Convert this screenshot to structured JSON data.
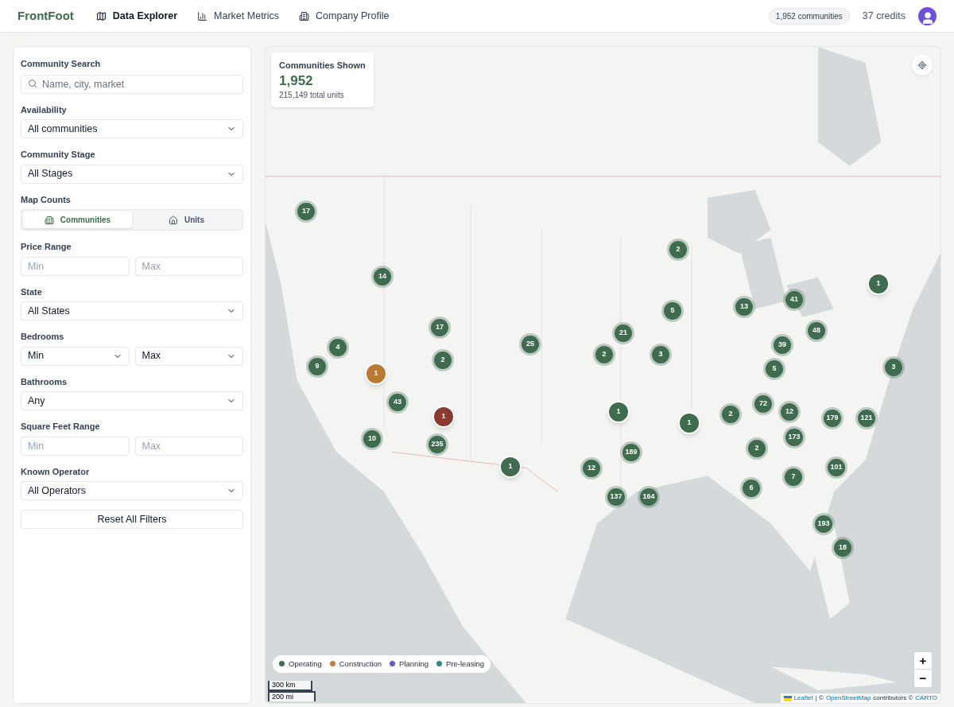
{
  "header": {
    "brand": "FrontFoot",
    "nav": [
      {
        "label": "Data Explorer",
        "selected": true
      },
      {
        "label": "Market Metrics",
        "selected": false
      },
      {
        "label": "Company Profile",
        "selected": false
      }
    ],
    "count_badge": "1,952 communities",
    "credits": "37 credits"
  },
  "filters": {
    "search": {
      "label": "Community Search",
      "placeholder": "Name, city, market"
    },
    "availability": {
      "label": "Availability",
      "value": "All communities"
    },
    "stage": {
      "label": "Community Stage",
      "value": "All Stages"
    },
    "map_counts": {
      "label": "Map Counts",
      "options": [
        {
          "label": "Communities",
          "selected": true
        },
        {
          "label": "Units",
          "selected": false
        }
      ]
    },
    "price": {
      "label": "Price Range",
      "min_placeholder": "Min",
      "max_placeholder": "Max"
    },
    "state": {
      "label": "State",
      "value": "All States"
    },
    "bedrooms": {
      "label": "Bedrooms",
      "min": "Min",
      "max": "Max"
    },
    "bathrooms": {
      "label": "Bathrooms",
      "value": "Any"
    },
    "sqft": {
      "label": "Square Feet Range",
      "min_placeholder": "Min",
      "max_placeholder": "Max"
    },
    "operator": {
      "label": "Known Operator",
      "value": "All Operators"
    },
    "reset": "Reset All Filters"
  },
  "map": {
    "summary": {
      "title": "Communities Shown",
      "value": "1,952",
      "sub": "215,149 total units"
    },
    "markers": [
      {
        "count": "17",
        "kind": "cluster",
        "color": "#3f6b4e"
      },
      {
        "count": "14",
        "kind": "cluster",
        "color": "#3f6b4e"
      },
      {
        "count": "2",
        "kind": "cluster",
        "color": "#3f6b4e"
      },
      {
        "count": "1",
        "kind": "single",
        "color": "#3f6b4e"
      },
      {
        "count": "17",
        "kind": "cluster",
        "color": "#3f6b4e"
      },
      {
        "count": "4",
        "kind": "cluster",
        "color": "#3f6b4e"
      },
      {
        "count": "5",
        "kind": "cluster",
        "color": "#3f6b4e"
      },
      {
        "count": "13",
        "kind": "cluster",
        "color": "#3f6b4e"
      },
      {
        "count": "41",
        "kind": "cluster",
        "color": "#3f6b4e"
      },
      {
        "count": "48",
        "kind": "cluster",
        "color": "#3f6b4e"
      },
      {
        "count": "9",
        "kind": "cluster",
        "color": "#3f6b4e"
      },
      {
        "count": "1",
        "kind": "single",
        "color": "#b87a35"
      },
      {
        "count": "2",
        "kind": "cluster",
        "color": "#3f6b4e"
      },
      {
        "count": "25",
        "kind": "cluster",
        "color": "#3f6b4e"
      },
      {
        "count": "21",
        "kind": "cluster",
        "color": "#3f6b4e"
      },
      {
        "count": "2",
        "kind": "cluster",
        "color": "#3f6b4e"
      },
      {
        "count": "3",
        "kind": "cluster",
        "color": "#3f6b4e"
      },
      {
        "count": "39",
        "kind": "cluster",
        "color": "#3f6b4e"
      },
      {
        "count": "5",
        "kind": "cluster",
        "color": "#3f6b4e"
      },
      {
        "count": "3",
        "kind": "cluster",
        "color": "#3f6b4e"
      },
      {
        "count": "43",
        "kind": "cluster",
        "color": "#3f6b4e"
      },
      {
        "count": "1",
        "kind": "single",
        "color": "#8a3a2e"
      },
      {
        "count": "1",
        "kind": "single",
        "color": "#3f6b4e"
      },
      {
        "count": "1",
        "kind": "single",
        "color": "#3f6b4e"
      },
      {
        "count": "2",
        "kind": "cluster",
        "color": "#3f6b4e"
      },
      {
        "count": "72",
        "kind": "cluster",
        "color": "#3f6b4e"
      },
      {
        "count": "12",
        "kind": "cluster",
        "color": "#3f6b4e"
      },
      {
        "count": "179",
        "kind": "cluster",
        "color": "#3f6b4e"
      },
      {
        "count": "121",
        "kind": "cluster",
        "color": "#3f6b4e"
      },
      {
        "count": "10",
        "kind": "cluster",
        "color": "#3f6b4e"
      },
      {
        "count": "235",
        "kind": "cluster",
        "color": "#3f6b4e"
      },
      {
        "count": "173",
        "kind": "cluster",
        "color": "#3f6b4e"
      },
      {
        "count": "189",
        "kind": "cluster",
        "color": "#3f6b4e"
      },
      {
        "count": "2",
        "kind": "cluster",
        "color": "#3f6b4e"
      },
      {
        "count": "1",
        "kind": "single",
        "color": "#3f6b4e"
      },
      {
        "count": "12",
        "kind": "cluster",
        "color": "#3f6b4e"
      },
      {
        "count": "101",
        "kind": "cluster",
        "color": "#3f6b4e"
      },
      {
        "count": "7",
        "kind": "cluster",
        "color": "#3f6b4e"
      },
      {
        "count": "137",
        "kind": "cluster",
        "color": "#3f6b4e"
      },
      {
        "count": "164",
        "kind": "cluster",
        "color": "#3f6b4e"
      },
      {
        "count": "6",
        "kind": "cluster",
        "color": "#3f6b4e"
      },
      {
        "count": "193",
        "kind": "cluster",
        "color": "#3f6b4e"
      },
      {
        "count": "18",
        "kind": "cluster",
        "color": "#3f6b4e"
      }
    ],
    "legend": [
      {
        "label": "Operating",
        "color": "#3f6b4e"
      },
      {
        "label": "Construction",
        "color": "#c47f3a"
      },
      {
        "label": "Planning",
        "color": "#6b5bbf"
      },
      {
        "label": "Pre-leasing",
        "color": "#2f8a86"
      }
    ],
    "zoom_in": "+",
    "zoom_out": "−",
    "scale": [
      "300 km",
      "200 mi"
    ],
    "attribution": {
      "leaflet": "Leaflet",
      "sep": "| ©",
      "osm": "OpenStreetMap",
      "contrib": "contributors ©",
      "carto": "CARTO"
    }
  }
}
